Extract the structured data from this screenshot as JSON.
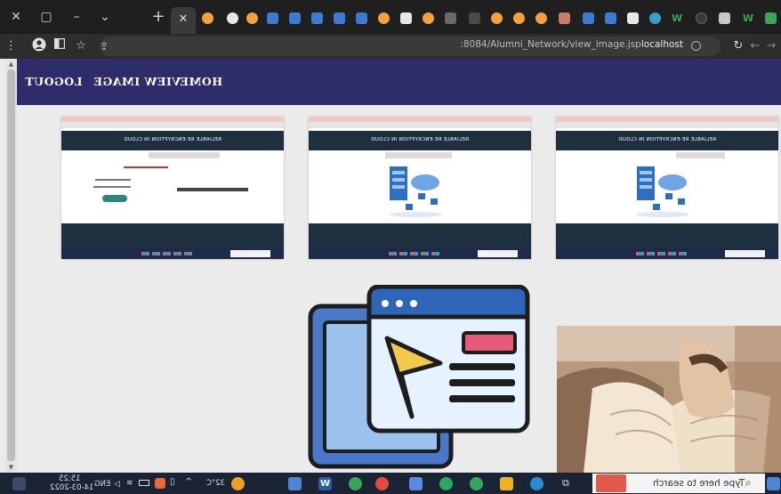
{
  "browser": {
    "new_tab_label": "+",
    "close_window_label": "✕",
    "active_tab_close_label": "✕",
    "url_host": "localhost",
    "url_path": ":8084/Alumni_Network/view_image.jsp"
  },
  "site": {
    "nav": {
      "home_label": "HOME",
      "view_image_label": "VIEW IMAGE",
      "logout_label": "LOGOUT"
    },
    "thumbnails": [
      {
        "title": "RELIABLE RE-ENCRYPTION IN CLOUD"
      },
      {
        "title": "RELIABLE RE-ENCRYPTION IN CLOUD"
      },
      {
        "title": "RELIABLE RE-ENCRYPTION IN CLOUD"
      }
    ]
  },
  "taskbar": {
    "search_placeholder": "Type here to search",
    "temperature": "32°C",
    "language": "ENG",
    "time": "15:25",
    "date": "14-03-2022"
  },
  "colors": {
    "navbar": "#2e2c6a",
    "thumb_header": "#1e3040",
    "taskbar": "#1b2435"
  }
}
